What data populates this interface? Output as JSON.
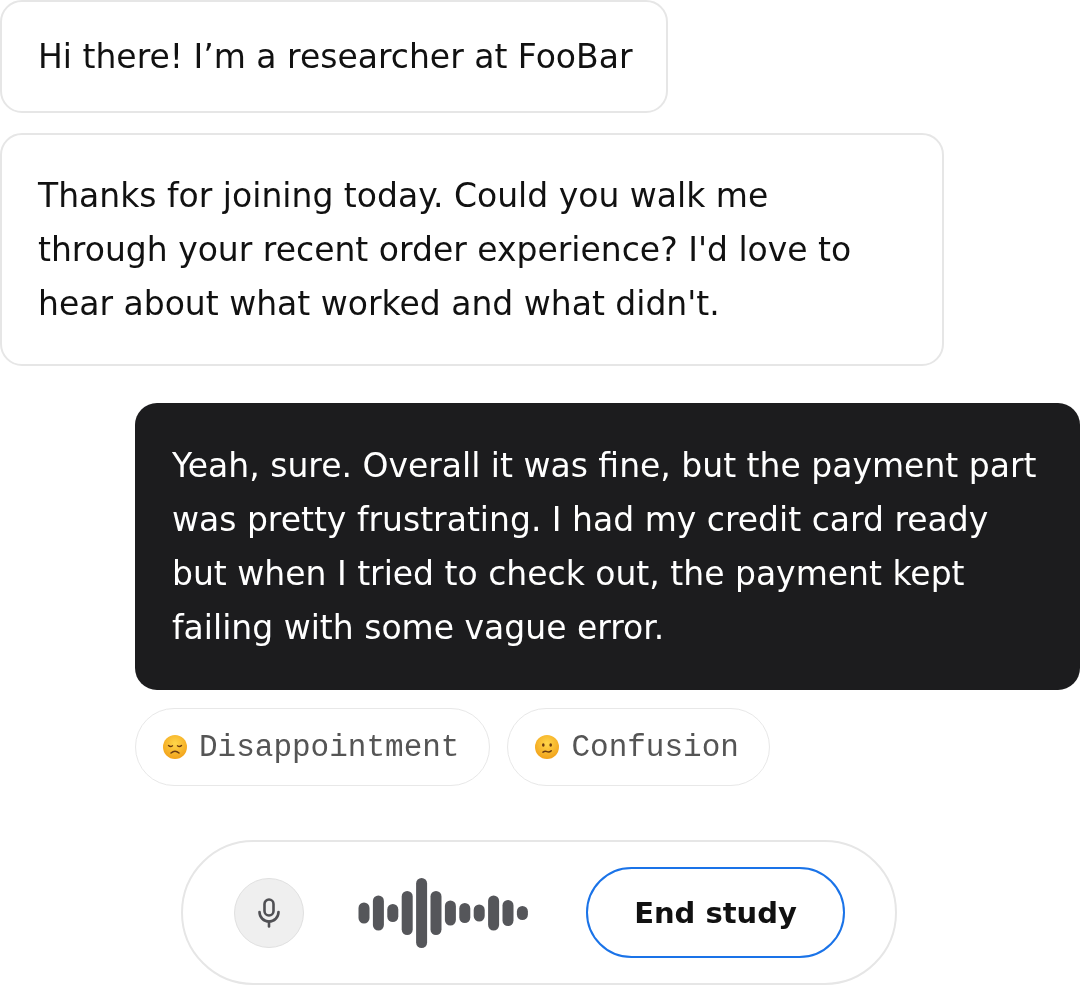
{
  "messages": [
    {
      "kind": "incoming",
      "text": "Hi there! I’m a researcher at FooBar"
    },
    {
      "kind": "incoming",
      "text": "Thanks for joining today. Could you walk me through your recent order experience? I'd love to hear about what worked and what didn't."
    },
    {
      "kind": "outgoing",
      "text": "Yeah, sure. Overall it was fine, but the payment part was pretty frustrating. I had my credit card ready but when I tried to check out, the payment kept failing with some vague error."
    }
  ],
  "emotion_tags": [
    {
      "kind": "disappointed",
      "label": "Disappointment"
    },
    {
      "kind": "confused",
      "label": "Confusion"
    }
  ],
  "voice_bar": {
    "end_button": "End study"
  }
}
